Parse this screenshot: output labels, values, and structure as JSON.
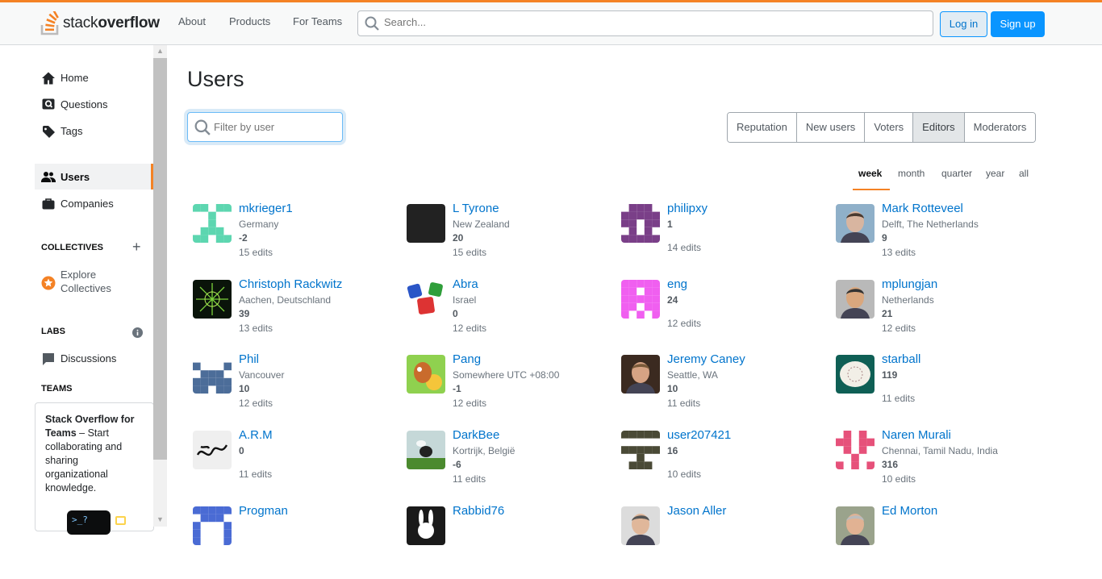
{
  "header": {
    "logo_text_light": "stack",
    "logo_text_bold": "overflow",
    "nav": [
      "About",
      "Products",
      "For Teams"
    ],
    "search_placeholder": "Search...",
    "login": "Log in",
    "signup": "Sign up",
    "accent_color": "#f48225"
  },
  "sidebar": {
    "items": [
      {
        "label": "Home",
        "icon": "home-icon"
      },
      {
        "label": "Questions",
        "icon": "questions-icon"
      },
      {
        "label": "Tags",
        "icon": "tag-icon"
      },
      {
        "label": "Users",
        "icon": "users-icon",
        "active": true
      },
      {
        "label": "Companies",
        "icon": "briefcase-icon"
      }
    ],
    "collectives_heading": "COLLECTIVES",
    "explore_collectives_line1": "Explore",
    "explore_collectives_line2": "Collectives",
    "labs_heading": "LABS",
    "discussions": "Discussions",
    "teams_heading": "TEAMS",
    "teams_promo_bold": "Stack Overflow for Teams",
    "teams_promo_rest": " – Start collaborating and sharing organizational knowledge."
  },
  "page": {
    "title": "Users",
    "filter_placeholder": "Filter by user",
    "tabs": [
      {
        "label": "Reputation"
      },
      {
        "label": "New users"
      },
      {
        "label": "Voters"
      },
      {
        "label": "Editors",
        "selected": true
      },
      {
        "label": "Moderators"
      }
    ],
    "periods": [
      {
        "label": "week",
        "selected": true
      },
      {
        "label": "month"
      },
      {
        "label": "quarter"
      },
      {
        "label": "year"
      },
      {
        "label": "all"
      }
    ]
  },
  "users": [
    {
      "name": "mkrieger1",
      "location": "Germany",
      "rep": "-2",
      "edits": "15 edits",
      "avatar": "identicon-teal"
    },
    {
      "name": "L Tyrone",
      "location": "New Zealand",
      "rep": "20",
      "edits": "15 edits",
      "avatar": "dark-square"
    },
    {
      "name": "philipxy",
      "location": "",
      "rep": "1",
      "edits": "14 edits",
      "avatar": "identicon-purple"
    },
    {
      "name": "Mark Rotteveel",
      "location": "Delft, The Netherlands",
      "rep": "9",
      "edits": "13 edits",
      "avatar": "photo-person"
    },
    {
      "name": "Christoph Rackwitz",
      "location": "Aachen, Deutschland",
      "rep": "39",
      "edits": "13 edits",
      "avatar": "fractal-green"
    },
    {
      "name": "Abra",
      "location": "Israel",
      "rep": "0",
      "edits": "12 edits",
      "avatar": "dice"
    },
    {
      "name": "eng",
      "location": "",
      "rep": "24",
      "edits": "12 edits",
      "avatar": "identicon-pink"
    },
    {
      "name": "mplungjan",
      "location": "Netherlands",
      "rep": "21",
      "edits": "12 edits",
      "avatar": "photo-sunglasses"
    },
    {
      "name": "Phil",
      "location": "Vancouver",
      "rep": "10",
      "edits": "12 edits",
      "avatar": "identicon-blue"
    },
    {
      "name": "Pang",
      "location": "Somewhere UTC +08:00",
      "rep": "-1",
      "edits": "12 edits",
      "avatar": "cartoon"
    },
    {
      "name": "Jeremy Caney",
      "location": "Seattle, WA",
      "rep": "10",
      "edits": "11 edits",
      "avatar": "photo-man"
    },
    {
      "name": "starball",
      "location": "",
      "rep": "119",
      "edits": "11 edits",
      "avatar": "ball-teal"
    },
    {
      "name": "A.R.M",
      "location": "",
      "rep": "0",
      "edits": "11 edits",
      "avatar": "calligraphy"
    },
    {
      "name": "DarkBee",
      "location": "Kortrijk, België",
      "rep": "-6",
      "edits": "11 edits",
      "avatar": "bee"
    },
    {
      "name": "user207421",
      "location": "",
      "rep": "16",
      "edits": "10 edits",
      "avatar": "identicon-olive"
    },
    {
      "name": "Naren Murali",
      "location": "Chennai, Tamil Nadu, India",
      "rep": "316",
      "edits": "10 edits",
      "avatar": "identicon-magenta"
    },
    {
      "name": "Progman",
      "location": "",
      "rep": "",
      "edits": "",
      "avatar": "identicon-blue2"
    },
    {
      "name": "Rabbid76",
      "location": "",
      "rep": "",
      "edits": "",
      "avatar": "rabbit"
    },
    {
      "name": "Jason Aller",
      "location": "",
      "rep": "",
      "edits": "",
      "avatar": "photo-glasses"
    },
    {
      "name": "Ed Morton",
      "location": "",
      "rep": "",
      "edits": "",
      "avatar": "photo-ed"
    }
  ]
}
